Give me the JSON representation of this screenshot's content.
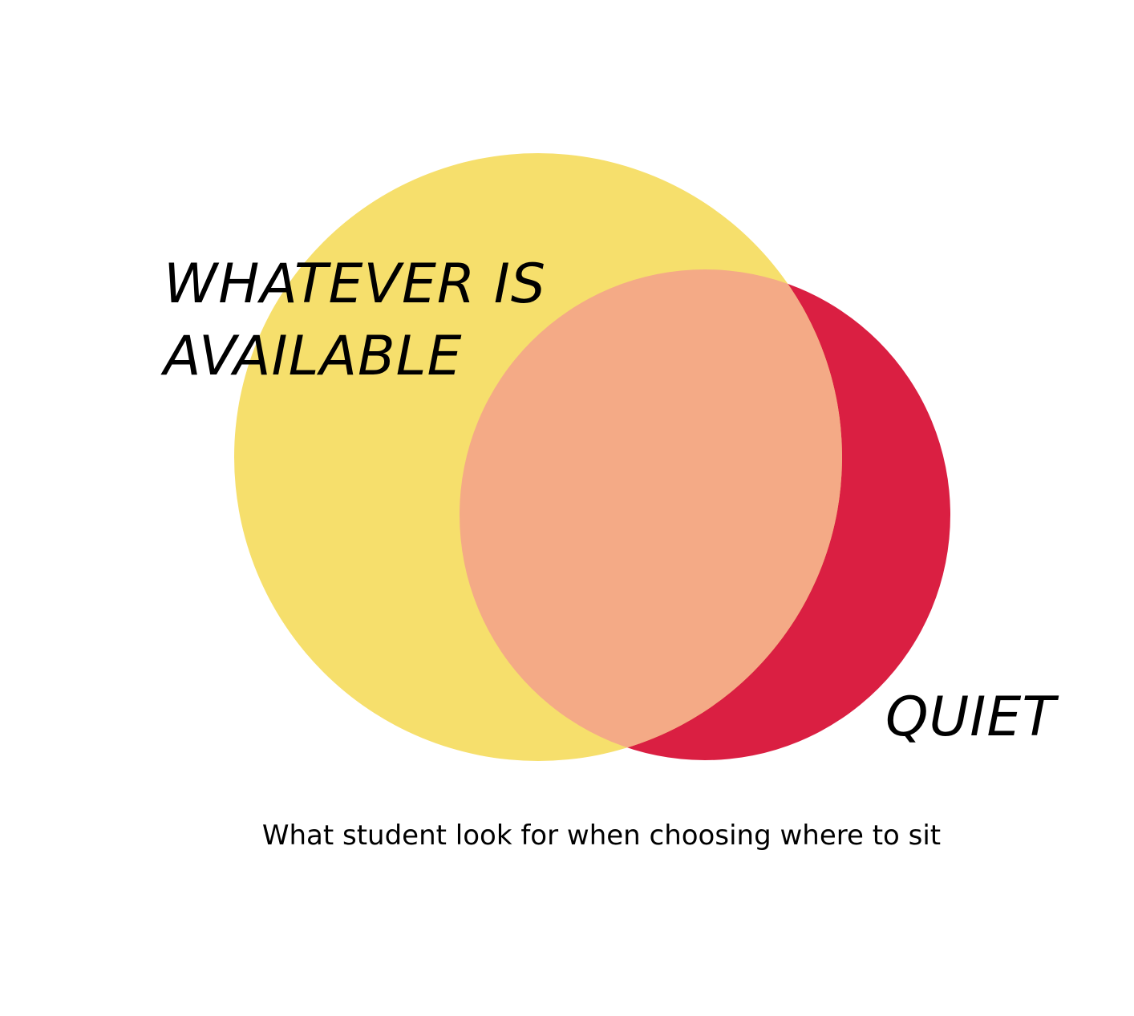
{
  "diagram": {
    "sets": [
      {
        "label_lines": [
          "WHATEVER IS",
          "AVAILABLE"
        ],
        "color": "#F6DF6C"
      },
      {
        "label_lines": [
          "QUIET"
        ],
        "color": "#DA1F42"
      }
    ],
    "overlap_color": "#F4AA86",
    "caption": "What student look for when choosing where to sit"
  }
}
